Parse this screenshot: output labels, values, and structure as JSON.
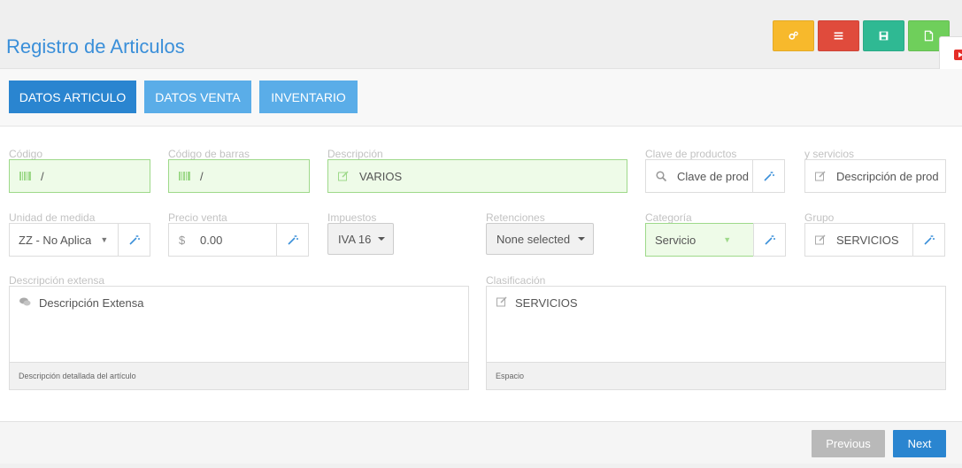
{
  "header": {
    "title": "Registro de Articulos",
    "toolbar": [
      {
        "name": "settings",
        "icon": "cogs-icon",
        "color": "#f7b92c"
      },
      {
        "name": "list",
        "icon": "list-icon",
        "color": "#e04b3c"
      },
      {
        "name": "save",
        "icon": "floppy-icon",
        "color": "#2fb993"
      },
      {
        "name": "new",
        "icon": "file-icon",
        "color": "#6fcf5b"
      }
    ]
  },
  "tabs": [
    {
      "label": "DATOS ARTICULO",
      "active": true
    },
    {
      "label": "DATOS VENTA",
      "active": false
    },
    {
      "label": "INVENTARIO",
      "active": false
    }
  ],
  "form": {
    "codigo": {
      "label": "Código",
      "value": "/"
    },
    "codigo_barras": {
      "label": "Código de barras",
      "value": "/"
    },
    "descripcion": {
      "label": "Descripción",
      "value": "VARIOS"
    },
    "clave_productos": {
      "label": "Clave de productos",
      "placeholder": "Clave de prod"
    },
    "servicios": {
      "label": "y servicios",
      "placeholder": "Descripción de prod"
    },
    "unidad_medida": {
      "label": "Unidad de medida",
      "value": "ZZ - No Aplica"
    },
    "precio_venta": {
      "label": "Precio venta",
      "prefix": "$",
      "value": "0.00"
    },
    "impuestos": {
      "label": "Impuestos",
      "value": "IVA 16"
    },
    "retenciones": {
      "label": "Retenciones",
      "value": "None selected"
    },
    "categoria": {
      "label": "Categoría",
      "value": "Servicio"
    },
    "grupo": {
      "label": "Grupo",
      "value": "SERVICIOS"
    },
    "descripcion_extensa": {
      "label": "Descripción extensa",
      "value": "Descripción Extensa",
      "footer": "Descripción detallada del artículo"
    },
    "clasificacion": {
      "label": "Clasificación",
      "value": "SERVICIOS",
      "footer": "Espacio"
    }
  },
  "footer": {
    "previous_label": "Previous",
    "next_label": "Next"
  },
  "colors": {
    "accent": "#3a8fd9",
    "tab_active": "#2a85d0",
    "tab_inactive": "#5aade8",
    "valid_bg": "#eefbe8",
    "valid_border": "#9ed98a"
  }
}
